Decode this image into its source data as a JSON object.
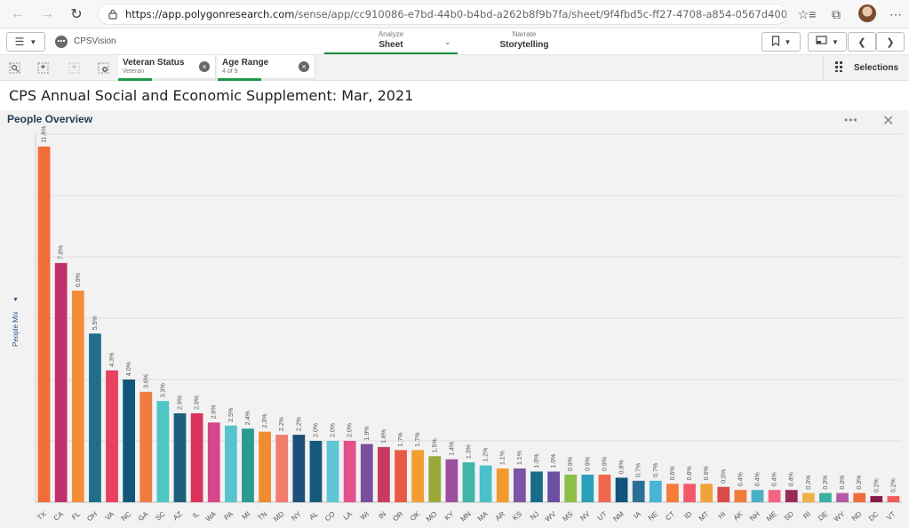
{
  "browser": {
    "url_host": "https://app.polygonresearch.com",
    "url_path": "/sense/app/cc910086-e7bd-44b0-b4bd-a262b8f9b7fa/sheet/9f4fbd5c-ff27-4708-a854-0567d4004b04/state/analysis"
  },
  "app_bar": {
    "app_name": "CPSVision",
    "analyze_small": "Analyze",
    "analyze_big": "Sheet",
    "narrate_small": "Narrate",
    "narrate_big": "Storytelling"
  },
  "selections_bar": {
    "chips": [
      {
        "title": "Veteran Status",
        "value": "Veteran"
      },
      {
        "title": "Age Range",
        "value": "4 of 9"
      }
    ],
    "selections_label": "Selections"
  },
  "sheet": {
    "title": "CPS Annual Social and Economic Supplement: Mar, 2021"
  },
  "panel": {
    "title": "People Overview",
    "y_label": "People Mix"
  },
  "chart_data": {
    "type": "bar",
    "ylabel": "People Mix",
    "ylim": [
      0,
      12
    ],
    "grid": true,
    "categories": [
      "TX",
      "CA",
      "FL",
      "OH",
      "VA",
      "NC",
      "GA",
      "SC",
      "AZ",
      "IL",
      "WA",
      "PA",
      "MI",
      "TN",
      "MD",
      "NY",
      "AL",
      "CO",
      "LA",
      "WI",
      "IN",
      "OR",
      "OK",
      "MO",
      "KY",
      "MN",
      "MA",
      "AR",
      "KS",
      "NJ",
      "WV",
      "MS",
      "NV",
      "UT",
      "NM",
      "IA",
      "NE",
      "CT",
      "ID",
      "MT",
      "HI",
      "AK",
      "NH",
      "ME",
      "SD",
      "RI",
      "DE",
      "WY",
      "ND",
      "DC",
      "VT"
    ],
    "values": [
      11.6,
      7.8,
      6.9,
      5.5,
      4.3,
      4.0,
      3.6,
      3.3,
      2.9,
      2.9,
      2.6,
      2.5,
      2.4,
      2.3,
      2.2,
      2.2,
      2.0,
      2.0,
      2.0,
      1.9,
      1.8,
      1.7,
      1.7,
      1.5,
      1.4,
      1.3,
      1.2,
      1.1,
      1.1,
      1.0,
      1.0,
      0.9,
      0.9,
      0.9,
      0.8,
      0.7,
      0.7,
      0.6,
      0.6,
      0.6,
      0.5,
      0.4,
      0.4,
      0.4,
      0.4,
      0.3,
      0.3,
      0.3,
      0.3,
      0.2,
      0.2
    ],
    "labels": [
      "11.6%",
      "7.8%",
      "6.9%",
      "5.5%",
      "4.3%",
      "4.0%",
      "3.6%",
      "3.3%",
      "2.9%",
      "2.9%",
      "2.6%",
      "2.5%",
      "2.4%",
      "2.3%",
      "2.2%",
      "2.2%",
      "2.0%",
      "2.0%",
      "2.0%",
      "1.9%",
      "1.8%",
      "1.7%",
      "1.7%",
      "1.5%",
      "1.4%",
      "1.3%",
      "1.2%",
      "1.1%",
      "1.1%",
      "1.0%",
      "1.0%",
      "0.9%",
      "0.9%",
      "0.9%",
      "0.8%",
      "0.7%",
      "0.7%",
      "0.6%",
      "0.6%",
      "0.6%",
      "0.5%",
      "0.4%",
      "0.4%",
      "0.4%",
      "0.4%",
      "0.3%",
      "0.3%",
      "0.3%",
      "0.3%",
      "0.2%",
      "0.2%"
    ],
    "colors": [
      "#f26c3a",
      "#c1306b",
      "#f58c3a",
      "#1f6f8b",
      "#e8405e",
      "#12577a",
      "#f07b3f",
      "#4dc6c4",
      "#1f5f7a",
      "#d9335b",
      "#d64688",
      "#58c3cc",
      "#2a9a8f",
      "#f28a2f",
      "#f27c6c",
      "#1e4f7a",
      "#155a7a",
      "#5ec6d6",
      "#e3508a",
      "#7b4f9e",
      "#c93a63",
      "#e85a47",
      "#f29d2f",
      "#9aa83a",
      "#9b4f9e",
      "#3fb6a8",
      "#4ac0c8",
      "#f39a2c",
      "#7a55a3",
      "#1a6b8a",
      "#6b4fa0",
      "#8bbf4a",
      "#2aa0b8",
      "#f0674e",
      "#12557a",
      "#2c6f94",
      "#4ab4d6",
      "#f47d3a",
      "#f25a6a",
      "#f0a33a",
      "#d94a4a",
      "#f07a3a",
      "#4ab0c4",
      "#f26480",
      "#9a2a5a",
      "#f2b04a",
      "#3ab0a0",
      "#b45aa8",
      "#f26c3a",
      "#8a1a4a",
      "#f25a5a"
    ]
  }
}
